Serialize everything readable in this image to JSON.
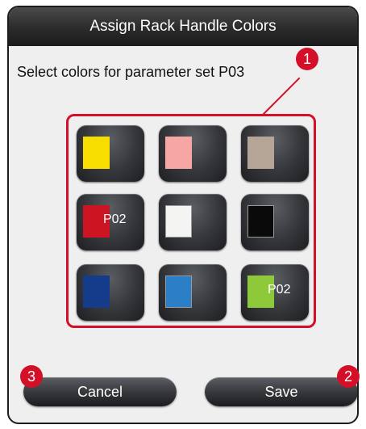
{
  "dialog": {
    "title": "Assign Rack Handle Colors",
    "prompt": "Select colors for parameter set P03"
  },
  "colors": [
    {
      "color": "#f8de00",
      "label": ""
    },
    {
      "color": "#f6a6a4",
      "label": ""
    },
    {
      "color": "#b5a596",
      "label": ""
    },
    {
      "color": "#cc1422",
      "label": "P02"
    },
    {
      "color": "#f4f4f2",
      "label": ""
    },
    {
      "color": "#0a0a0a",
      "label": ""
    },
    {
      "color": "#153c8a",
      "label": ""
    },
    {
      "color": "#2b7fc6",
      "label": ""
    },
    {
      "color": "#8ec93a",
      "label": "P02"
    }
  ],
  "buttons": {
    "cancel_label": "Cancel",
    "save_label": "Save"
  },
  "callouts": {
    "grid": "1",
    "save": "2",
    "cancel": "3"
  },
  "accent_color": "#d40f28"
}
